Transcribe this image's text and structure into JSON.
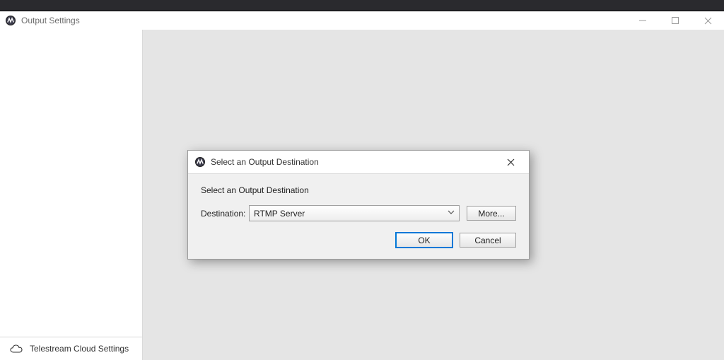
{
  "window": {
    "title": "Output Settings"
  },
  "sidebar": {
    "footer_label": "Telestream Cloud Settings"
  },
  "dialog": {
    "title": "Select an Output Destination",
    "heading": "Select an Output Destination",
    "destination_label": "Destination:",
    "destination_value": "RTMP Server",
    "more_label": "More...",
    "ok_label": "OK",
    "cancel_label": "Cancel"
  }
}
